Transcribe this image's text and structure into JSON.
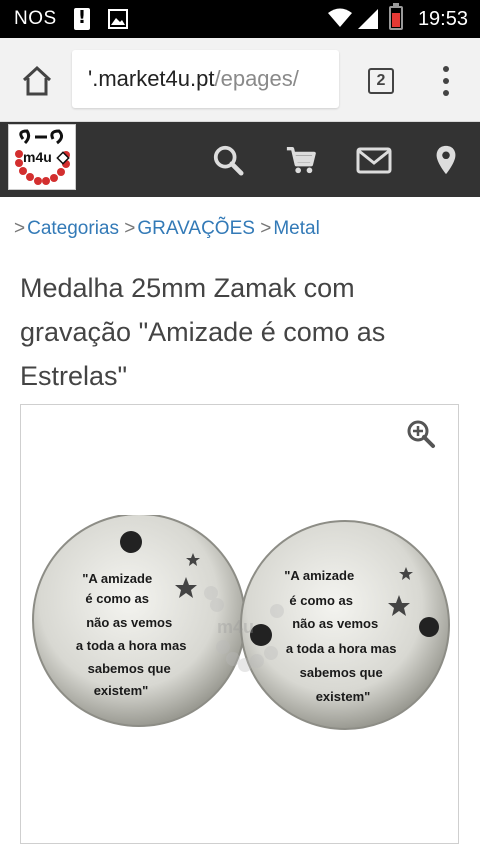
{
  "status_bar": {
    "carrier": "NOS",
    "time": "19:53"
  },
  "browser": {
    "url_host": "market4u.pt",
    "url_path": "/epages/",
    "url_prefix": "'.",
    "tab_count": "2"
  },
  "site": {
    "logo_text": "m4u",
    "header_icons": [
      "search-icon",
      "cart-icon",
      "mail-icon",
      "location-pin-icon"
    ],
    "header_bg": "#333333"
  },
  "breadcrumb": {
    "items": [
      "Categorias",
      "GRAVAÇÕES",
      "Metal"
    ],
    "separator": ">"
  },
  "product": {
    "title": "Medalha 25mm Zamak com gravação \"Amizade é como as Estrelas\"",
    "medal_text_lines": [
      "\"A amizade",
      "é como as",
      "não as vemos",
      "a toda a hora mas",
      "sabemos que",
      "existem\""
    ],
    "watermark": "m4u"
  },
  "colors": {
    "link": "#337ab7",
    "battery_low": "#e53935"
  }
}
